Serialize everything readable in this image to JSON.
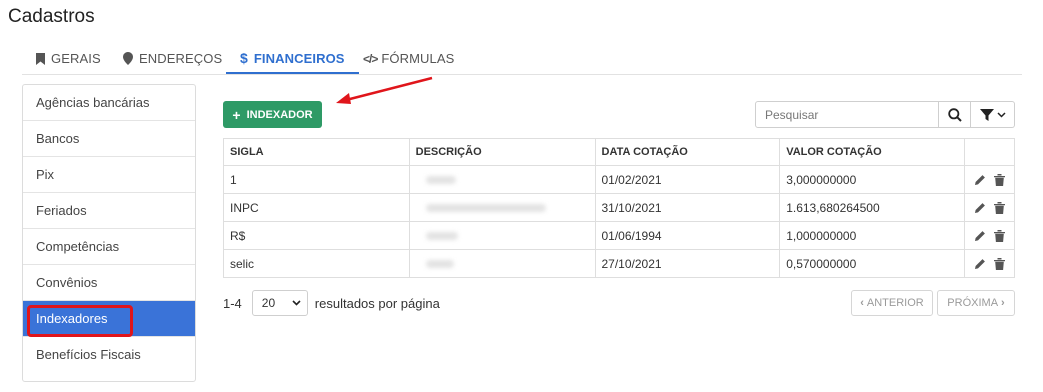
{
  "page": {
    "title": "Cadastros"
  },
  "tabs": [
    {
      "label": "GERAIS",
      "icon": "bookmark-icon"
    },
    {
      "label": "ENDEREÇOS",
      "icon": "map-pin-icon"
    },
    {
      "label": "FINANCEIROS",
      "icon": "dollar-icon",
      "active": true
    },
    {
      "label": "FÓRMULAS",
      "icon": "code-icon"
    }
  ],
  "sidebar": {
    "items": [
      {
        "label": "Agências bancárias"
      },
      {
        "label": "Bancos"
      },
      {
        "label": "Pix"
      },
      {
        "label": "Feriados"
      },
      {
        "label": "Competências"
      },
      {
        "label": "Convênios"
      },
      {
        "label": "Indexadores",
        "active": true
      },
      {
        "label": "Benefícios Fiscais"
      }
    ]
  },
  "toolbar": {
    "add_label": "INDEXADOR",
    "search_placeholder": "Pesquisar"
  },
  "table": {
    "headers": [
      "SIGLA",
      "DESCRIÇÃO",
      "DATA COTAÇÃO",
      "VALOR COTAÇÃO",
      ""
    ],
    "rows": [
      {
        "sigla": "1",
        "data": "01/02/2021",
        "valor": "3,000000000"
      },
      {
        "sigla": "INPC",
        "data": "31/10/2021",
        "valor": "1.613,680264500"
      },
      {
        "sigla": "R$",
        "data": "01/06/1994",
        "valor": "1,000000000"
      },
      {
        "sigla": "selic",
        "data": "27/10/2021",
        "valor": "0,570000000"
      }
    ]
  },
  "pagination": {
    "range": "1-4",
    "per_page": "20",
    "per_page_suffix": "resultados por página",
    "prev_label": "ANTERIOR",
    "next_label": "PRÓXIMA"
  },
  "colors": {
    "accent": "#2f6fcf",
    "sidebar_active": "#3a73d8",
    "add_button": "#2e9a66",
    "annotation": "#e0151b"
  }
}
